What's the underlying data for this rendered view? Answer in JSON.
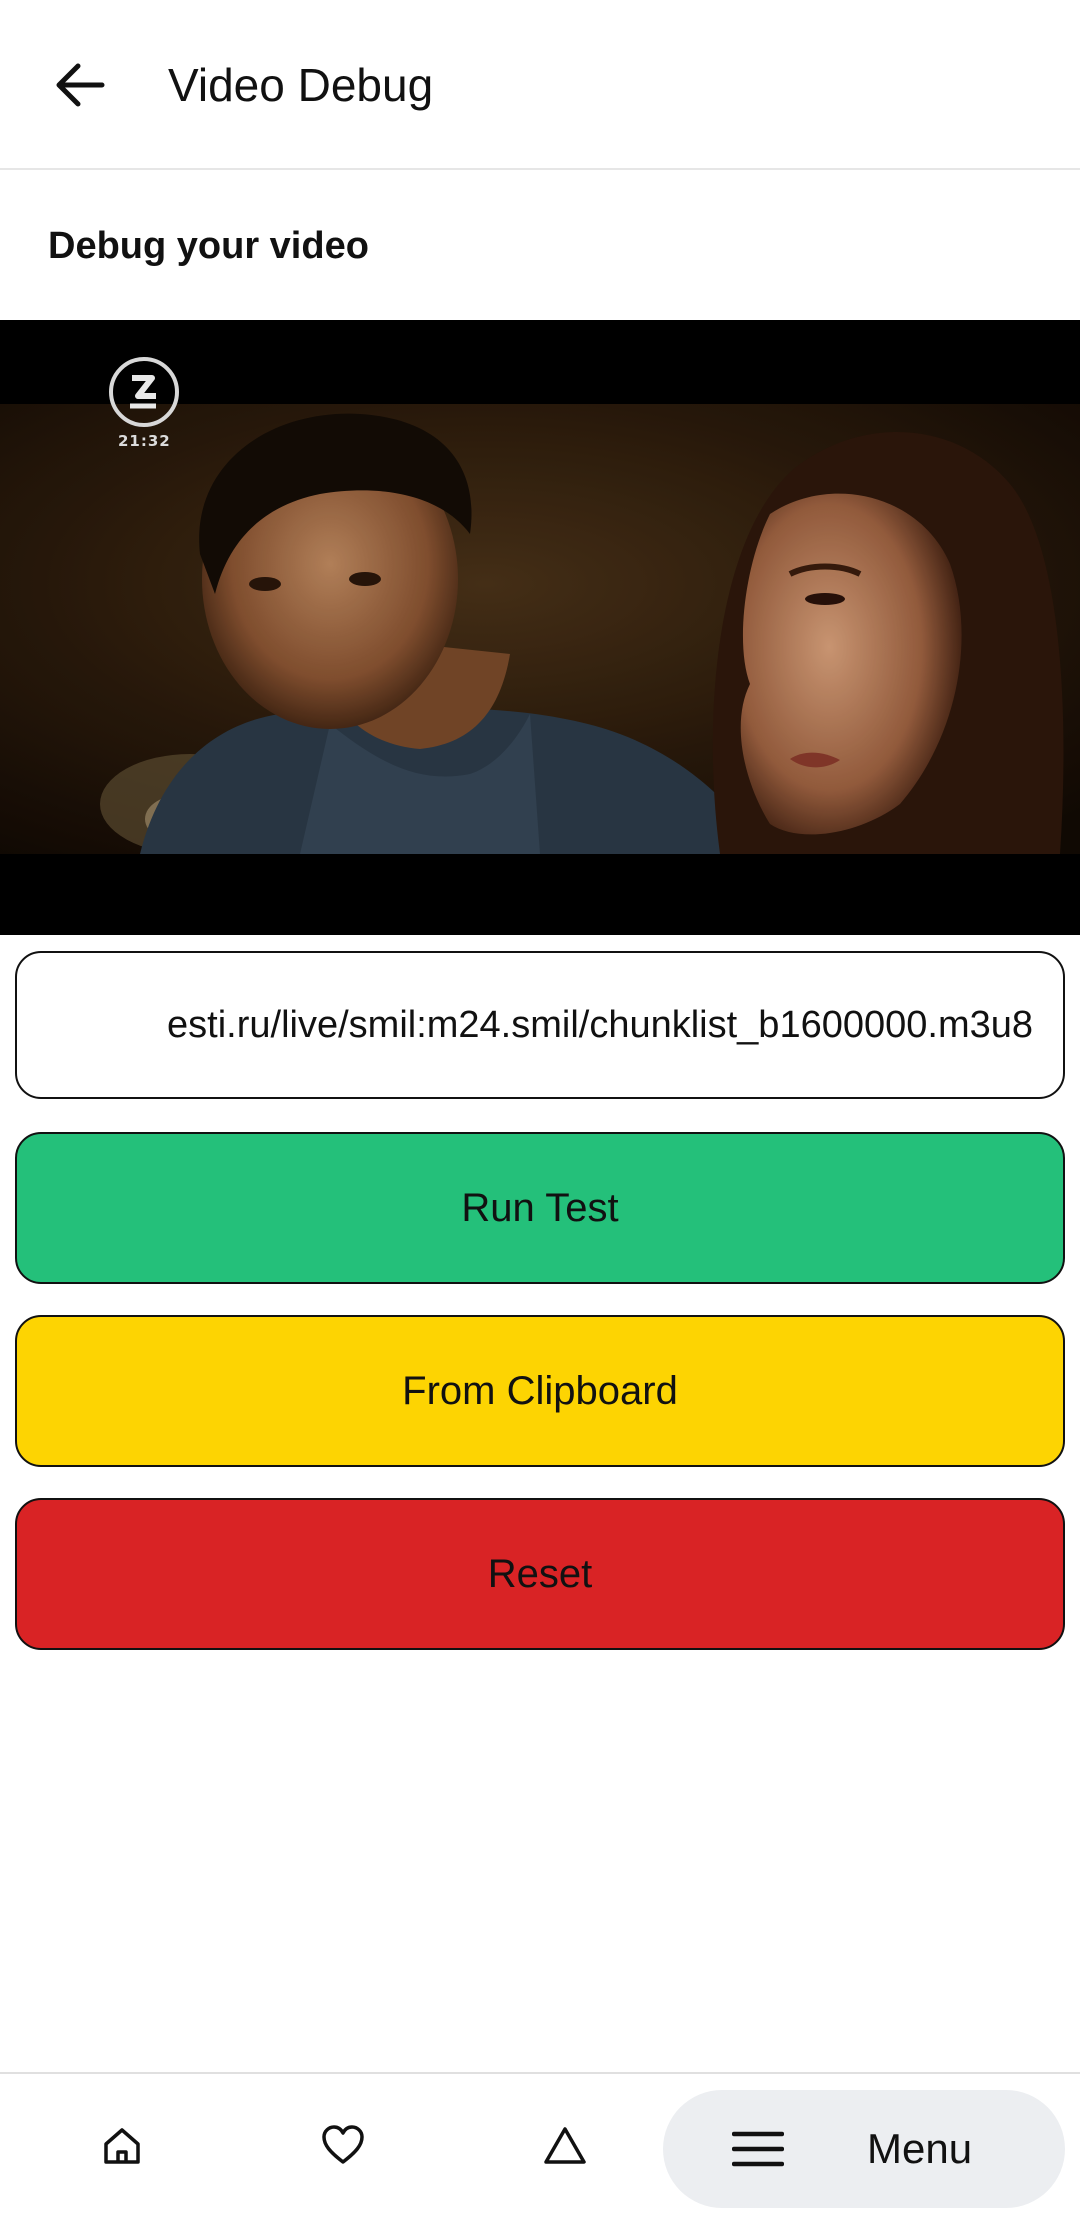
{
  "app_bar": {
    "back_icon": "arrow-left-icon",
    "title": "Video Debug"
  },
  "section": {
    "title": "Debug your video"
  },
  "video": {
    "channel_logo_icon": "channel-logo-icon",
    "overlay_time": "21:32"
  },
  "url_field": {
    "value": "esti.ru/live/smil:m24.smil/chunklist_b1600000.m3u8"
  },
  "buttons": {
    "run_test": "Run Test",
    "from_clipboard": "From Clipboard",
    "reset": "Reset"
  },
  "colors": {
    "run_test": "#24c07a",
    "from_clipboard": "#fdd402",
    "reset": "#d92325",
    "menu_pill": "#eceef1"
  },
  "bottom_nav": {
    "items": [
      {
        "icon": "home-icon"
      },
      {
        "icon": "heart-icon"
      },
      {
        "icon": "triangle-icon"
      }
    ],
    "menu": {
      "icon": "hamburger-icon",
      "label": "Menu"
    }
  }
}
